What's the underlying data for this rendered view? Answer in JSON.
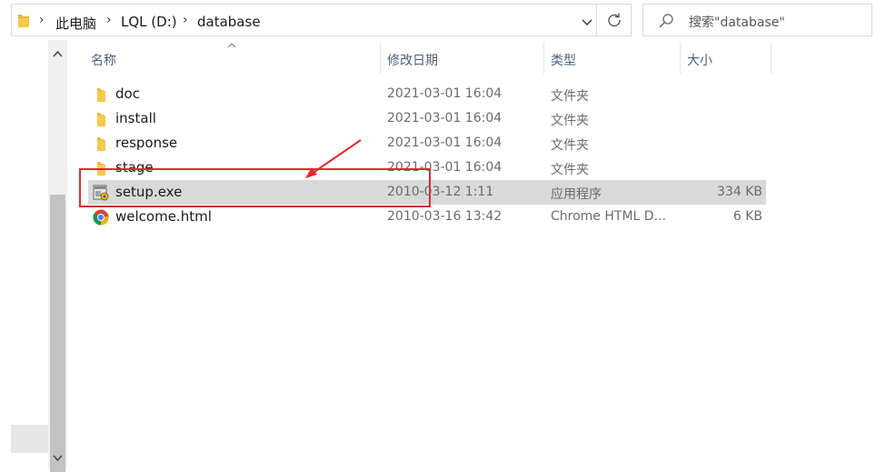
{
  "breadcrumb": {
    "items": [
      "此电脑",
      "LQL (D:)",
      "database"
    ]
  },
  "search": {
    "placeholder": "搜索\"database\""
  },
  "columns": {
    "name": "名称",
    "modified": "修改日期",
    "type": "类型",
    "size": "大小"
  },
  "files": [
    {
      "name": "doc",
      "modified": "2021-03-01 16:04",
      "type": "文件夹",
      "size": "",
      "icon": "folder-icon"
    },
    {
      "name": "install",
      "modified": "2021-03-01 16:04",
      "type": "文件夹",
      "size": "",
      "icon": "folder-icon"
    },
    {
      "name": "response",
      "modified": "2021-03-01 16:04",
      "type": "文件夹",
      "size": "",
      "icon": "folder-icon"
    },
    {
      "name": "stage",
      "modified": "2021-03-01 16:04",
      "type": "文件夹",
      "size": "",
      "icon": "folder-icon"
    },
    {
      "name": "setup.exe",
      "modified": "2010-03-12 1:11",
      "type": "应用程序",
      "size": "334 KB",
      "icon": "exe-icon",
      "selected": true
    },
    {
      "name": "welcome.html",
      "modified": "2010-03-16 13:42",
      "type": "Chrome HTML D...",
      "size": "6 KB",
      "icon": "chrome-icon"
    }
  ],
  "colors": {
    "selection": "#d9d9d9",
    "annotation": "#e02a2a",
    "folder": "#f7c948",
    "header_text": "#4c607a"
  }
}
